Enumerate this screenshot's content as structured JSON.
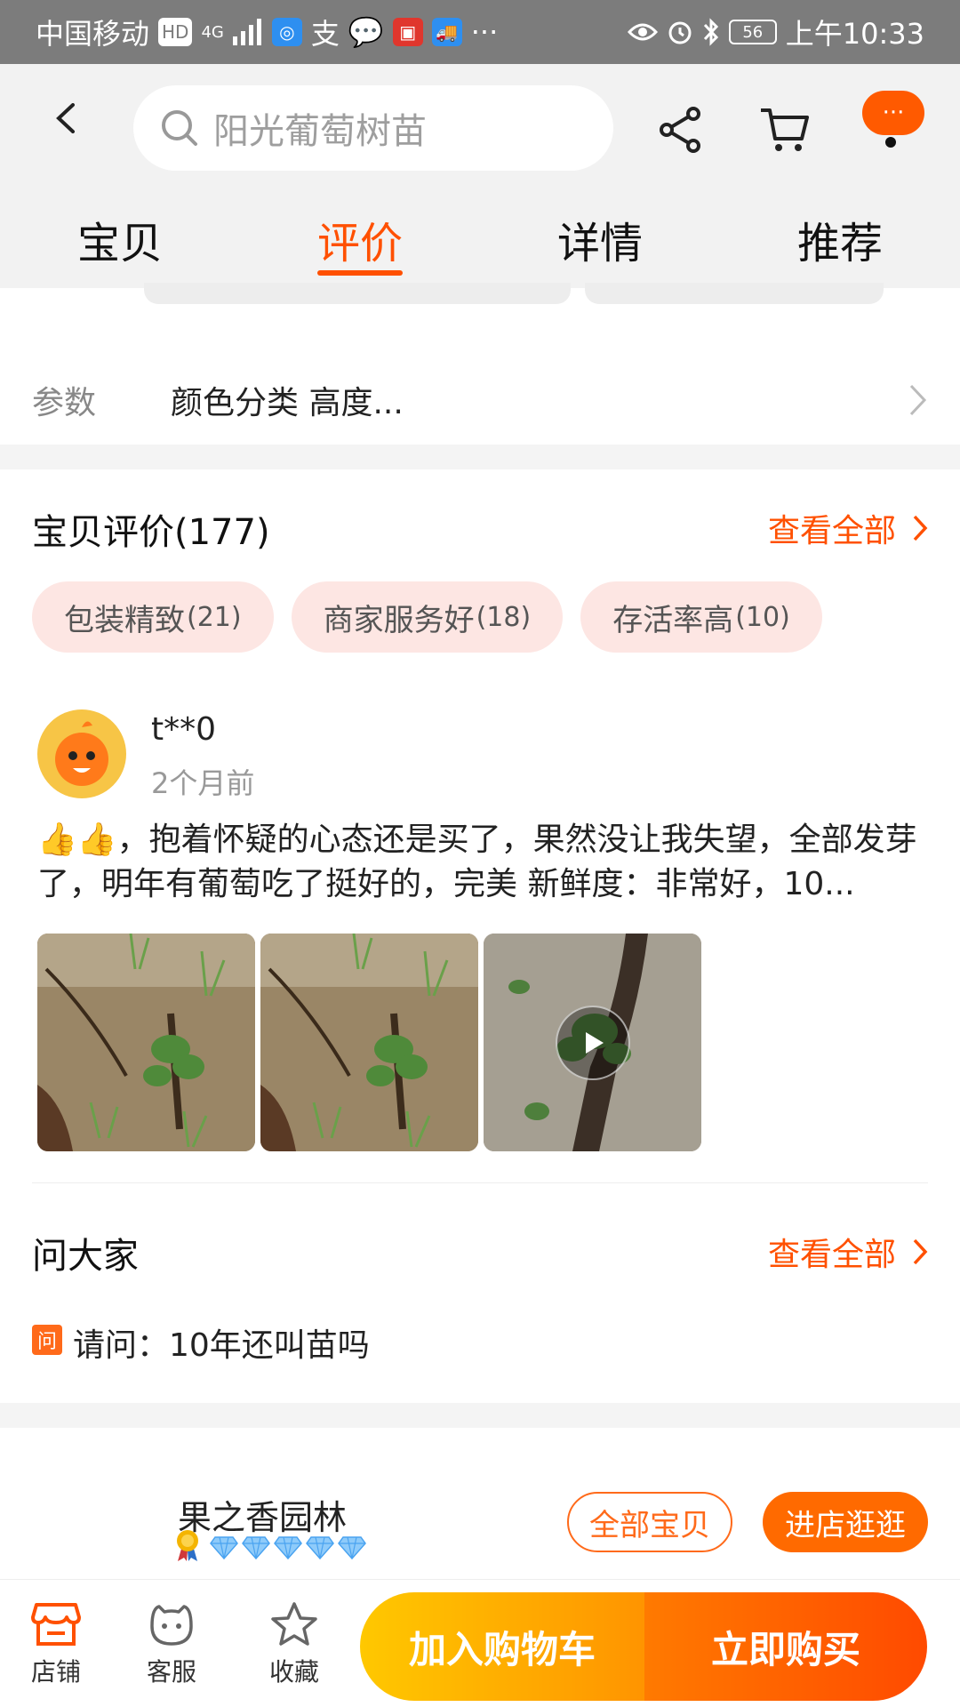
{
  "status_bar": {
    "carrier": "中国移动",
    "hd": "HD",
    "network": "4G",
    "dots": "···",
    "battery": "56",
    "time": "上午10:33"
  },
  "header": {
    "search_placeholder": "阳光葡萄树苗",
    "more_label": "···"
  },
  "tabs": [
    {
      "label": "宝贝",
      "active": false
    },
    {
      "label": "评价",
      "active": true
    },
    {
      "label": "详情",
      "active": false
    },
    {
      "label": "推荐",
      "active": false
    }
  ],
  "params": {
    "label": "参数",
    "value": "颜色分类 高度..."
  },
  "reviews": {
    "title": "宝贝评价(177)",
    "view_all": "查看全部",
    "tags": [
      {
        "label": "包装精致",
        "count": "(21)"
      },
      {
        "label": "商家服务好",
        "count": "(18)"
      },
      {
        "label": "存活率高",
        "count": "(10)"
      }
    ],
    "item": {
      "user": "t**0",
      "time": "2个月前",
      "text": "👍👍，抱着怀疑的心态还是买了，果然没让我失望，全部发芽了，明年有葡萄吃了挺好的，完美 新鲜度：非常好，10..."
    }
  },
  "qa": {
    "title": "问大家",
    "view_all": "查看全部",
    "badge": "问",
    "question": "请问：10年还叫苗吗"
  },
  "shop": {
    "name": "果之香园林",
    "all_items": "全部宝贝",
    "enter_shop": "进店逛逛"
  },
  "bottom_bar": {
    "store": "店铺",
    "service": "客服",
    "favorite": "收藏",
    "add_to_cart": "加入购物车",
    "buy_now": "立即购买"
  }
}
